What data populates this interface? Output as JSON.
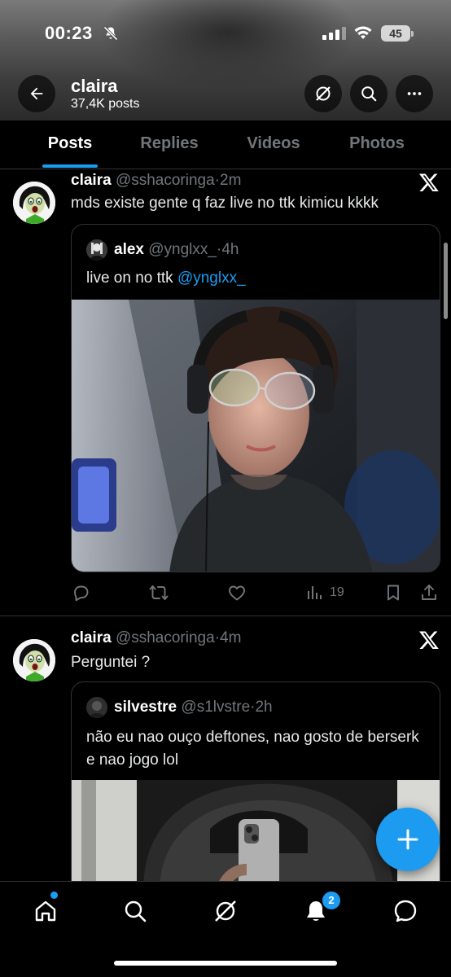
{
  "status_bar": {
    "time": "00:23",
    "battery": "45"
  },
  "header": {
    "name": "claira",
    "post_count": "37,4K posts"
  },
  "tabs": [
    {
      "label": "Posts",
      "active": true
    },
    {
      "label": "Replies",
      "active": false
    },
    {
      "label": "Videos",
      "active": false
    },
    {
      "label": "Photos",
      "active": false
    }
  ],
  "posts": [
    {
      "name": "claira",
      "handle": "@sshacoringa",
      "time": "2m",
      "text": "mds existe gente q faz live no ttk kimicu kkkk",
      "quote": {
        "name": "alex",
        "handle": "@ynglxx_",
        "time": "4h",
        "text": "live on no ttk ",
        "mention": "@ynglxx_"
      },
      "views": "19"
    },
    {
      "name": "claira",
      "handle": "@sshacoringa",
      "time": "4m",
      "text": "Perguntei ?",
      "quote": {
        "name": "silvestre",
        "handle": "@s1lvstre",
        "time": "2h",
        "text": "não eu nao ouço deftones, nao gosto de berserk e nao jogo lol"
      }
    }
  ],
  "nav": {
    "notifications_badge": "2"
  },
  "colors": {
    "accent": "#1d9bf0",
    "background": "#000000",
    "muted": "#71767b",
    "border": "#2f3336"
  }
}
